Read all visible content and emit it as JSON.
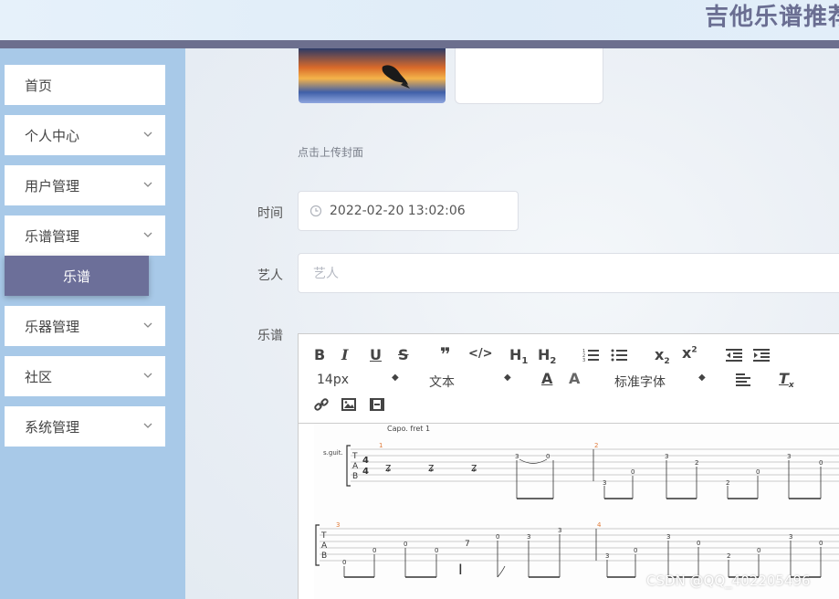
{
  "header": {
    "title": "吉他乐谱推荐"
  },
  "sidebar": {
    "items": [
      {
        "label": "首页",
        "expandable": false
      },
      {
        "label": "个人中心",
        "expandable": true
      },
      {
        "label": "用户管理",
        "expandable": true
      },
      {
        "label": "乐谱管理",
        "expandable": true
      },
      {
        "label": "乐器管理",
        "expandable": true
      },
      {
        "label": "社区",
        "expandable": true
      },
      {
        "label": "系统管理",
        "expandable": true
      }
    ],
    "active_sub": {
      "label": "乐谱"
    }
  },
  "form": {
    "cover_tip": "点击上传封面",
    "time_label": "时间",
    "time_value": "2022-02-20 13:02:06",
    "artist_label": "艺人",
    "artist_placeholder": "艺人",
    "score_label": "乐谱"
  },
  "editor": {
    "font_size": "14px",
    "block_type": "文本",
    "font_family": "标准字体",
    "score": {
      "capo": "Capo. fret 1",
      "instrument": "s.guit.",
      "time_signature": "4/4",
      "measures": [
        "1",
        "2",
        "3",
        "4"
      ]
    }
  },
  "watermark": "CSDN @QQ_402205496",
  "colors": {
    "accent": "#6c6f99",
    "sidebar_bg": "#a8c9e8",
    "header_bar": "#6c6f8e"
  }
}
